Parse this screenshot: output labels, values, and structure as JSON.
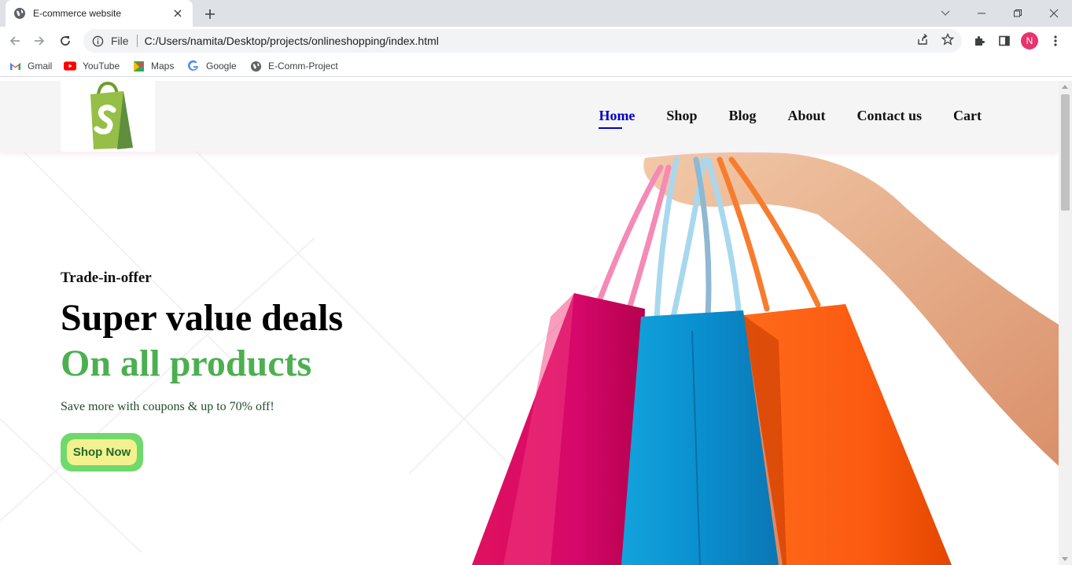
{
  "browser": {
    "tab_title": "E-commerce website",
    "url_scheme": "File",
    "url": "C:/Users/namita/Desktop/projects/onlineshopping/index.html",
    "profile_initial": "N",
    "bookmarks": [
      {
        "label": "Gmail",
        "icon": "gmail-icon"
      },
      {
        "label": "YouTube",
        "icon": "youtube-icon"
      },
      {
        "label": "Maps",
        "icon": "maps-icon"
      },
      {
        "label": "Google",
        "icon": "google-icon"
      },
      {
        "label": "E-Comm-Project",
        "icon": "globe-icon"
      }
    ]
  },
  "site": {
    "nav": [
      {
        "label": "Home",
        "active": true
      },
      {
        "label": "Shop"
      },
      {
        "label": "Blog"
      },
      {
        "label": "About"
      },
      {
        "label": "Contact us"
      },
      {
        "label": "Cart"
      }
    ],
    "hero": {
      "offer": "Trade-in-offer",
      "headline": "Super value deals",
      "subline": "On all products",
      "tagline": "Save more with coupons & up to 70% off!",
      "button": "Shop Now"
    },
    "colors": {
      "accent_green": "#4caf50",
      "nav_active": "#0000cc",
      "button_outer": "#6fd96c",
      "button_inner": "#f3f08e"
    }
  }
}
